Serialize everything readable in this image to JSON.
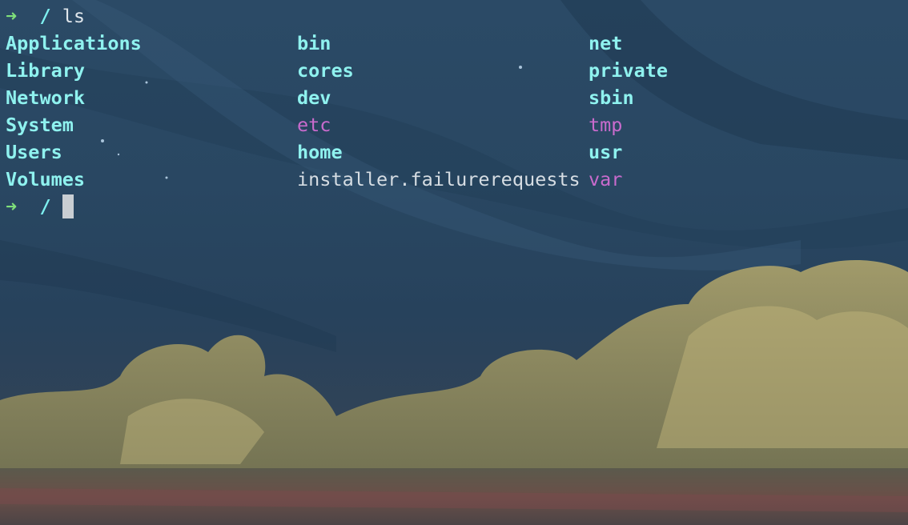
{
  "prompt": {
    "arrow": "➜",
    "path": "/"
  },
  "command": "ls",
  "listing": [
    [
      {
        "name": "Applications",
        "kind": "dir"
      },
      {
        "name": "Library",
        "kind": "dir"
      },
      {
        "name": "Network",
        "kind": "dir"
      },
      {
        "name": "System",
        "kind": "dir"
      },
      {
        "name": "Users",
        "kind": "dir"
      },
      {
        "name": "Volumes",
        "kind": "dir"
      }
    ],
    [
      {
        "name": "bin",
        "kind": "dir"
      },
      {
        "name": "cores",
        "kind": "dir"
      },
      {
        "name": "dev",
        "kind": "dir"
      },
      {
        "name": "etc",
        "kind": "symlink"
      },
      {
        "name": "home",
        "kind": "dir"
      },
      {
        "name": "installer.failurerequests",
        "kind": "file"
      }
    ],
    [
      {
        "name": "net",
        "kind": "dir"
      },
      {
        "name": "private",
        "kind": "dir"
      },
      {
        "name": "sbin",
        "kind": "dir"
      },
      {
        "name": "tmp",
        "kind": "symlink"
      },
      {
        "name": "usr",
        "kind": "dir"
      },
      {
        "name": "var",
        "kind": "symlink"
      }
    ]
  ],
  "colors": {
    "arrow": "#7fe07a",
    "path": "#7ef0f0",
    "directory": "#8ff2ef",
    "symlink": "#c96bcd",
    "file": "#d6dde3",
    "cursor": "#c9ced3"
  }
}
